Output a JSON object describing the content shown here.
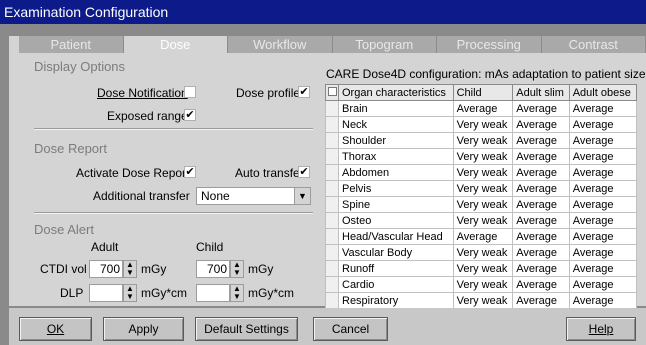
{
  "window": {
    "title": "Examination Configuration"
  },
  "tabs": [
    {
      "label": "Patient",
      "active": false
    },
    {
      "label": "Dose",
      "active": true
    },
    {
      "label": "Workflow",
      "active": false
    },
    {
      "label": "Topogram",
      "active": false
    },
    {
      "label": "Processing",
      "active": false
    },
    {
      "label": "Contrast",
      "active": false
    }
  ],
  "display_options": {
    "title": "Display Options",
    "dose_notification": {
      "label": "Dose Notification",
      "checked": false
    },
    "dose_profile": {
      "label": "Dose profile",
      "checked": true,
      "mark": "✔"
    },
    "exposed_range": {
      "label": "Exposed range",
      "checked": true,
      "mark": "✔"
    }
  },
  "dose_report": {
    "title": "Dose Report",
    "activate": {
      "label": "Activate Dose Report",
      "checked": true,
      "mark": "✔"
    },
    "auto_transfer": {
      "label": "Auto transfer",
      "checked": true,
      "mark": "✔"
    },
    "additional_transfer": {
      "label": "Additional transfer",
      "value": "None"
    }
  },
  "dose_alert": {
    "title": "Dose Alert",
    "adult_label": "Adult",
    "child_label": "Child",
    "ctdi_label": "CTDI vol",
    "dlp_label": "DLP",
    "ctdi_adult": "700",
    "ctdi_child": "700",
    "dlp_adult": "",
    "dlp_child": "",
    "ctdi_unit": "mGy",
    "dlp_unit": "mGy*cm"
  },
  "care": {
    "title": "CARE Dose4D configuration: mAs adaptation to patient size",
    "headers": [
      "Organ characteristics",
      "Child",
      "Adult slim",
      "Adult obese"
    ],
    "rows": [
      [
        "Brain",
        "Average",
        "Average",
        "Average"
      ],
      [
        "Neck",
        "Very weak",
        "Average",
        "Average"
      ],
      [
        "Shoulder",
        "Very weak",
        "Average",
        "Average"
      ],
      [
        "Thorax",
        "Very weak",
        "Average",
        "Average"
      ],
      [
        "Abdomen",
        "Very weak",
        "Average",
        "Average"
      ],
      [
        "Pelvis",
        "Very weak",
        "Average",
        "Average"
      ],
      [
        "Spine",
        "Very weak",
        "Average",
        "Average"
      ],
      [
        "Osteo",
        "Very weak",
        "Average",
        "Average"
      ],
      [
        "Head/Vascular Head",
        "Average",
        "Average",
        "Average"
      ],
      [
        "Vascular Body",
        "Very weak",
        "Average",
        "Average"
      ],
      [
        "Runoff",
        "Very weak",
        "Average",
        "Average"
      ],
      [
        "Cardio",
        "Very weak",
        "Average",
        "Average"
      ],
      [
        "Respiratory",
        "Very weak",
        "Average",
        "Average"
      ]
    ]
  },
  "buttons": {
    "ok": "OK",
    "apply": "Apply",
    "default_settings": "Default Settings",
    "cancel": "Cancel",
    "help": "Help"
  },
  "icons": {
    "spin_up": "▲",
    "spin_down": "▼",
    "dropdown": "▼"
  },
  "colors": {
    "titlebar": "#0d1a8a",
    "panel": "#d4d4d4",
    "section_title": "#7c7c7c"
  }
}
